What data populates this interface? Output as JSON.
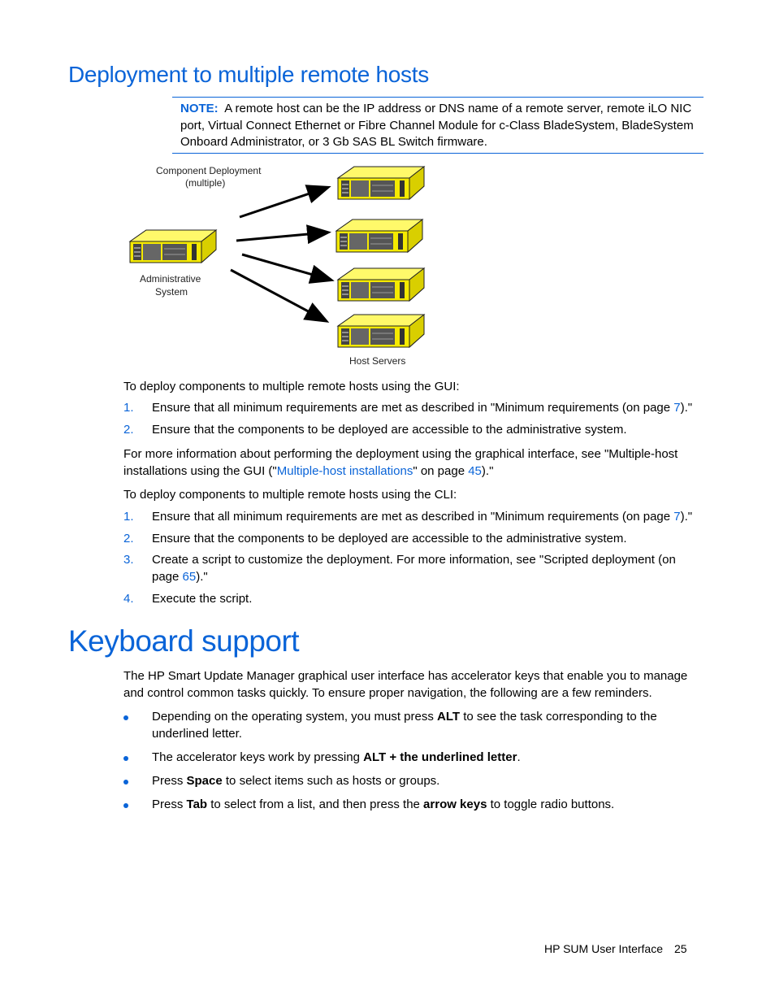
{
  "section1": {
    "title": "Deployment to multiple remote hosts",
    "note": {
      "label": "NOTE:",
      "text": "A remote host can be the IP address or DNS name of a remote server, remote iLO NIC port, Virtual Connect Ethernet or Fibre Channel Module for c-Class BladeSystem, BladeSystem Onboard Administrator, or 3 Gb SAS BL Switch firmware."
    },
    "figure": {
      "caption_top_line1": "Component Deployment",
      "caption_top_line2": "(multiple)",
      "admin_label_line1": "Administrative",
      "admin_label_line2": "System",
      "hosts_label": "Host Servers",
      "host_count": 4
    },
    "gui_intro": "To deploy components to multiple remote hosts using the GUI:",
    "gui_steps": [
      {
        "num": "1.",
        "pre": "Ensure that all minimum requirements are met as described in \"Minimum requirements (on page ",
        "link": "7",
        "post": ").\""
      },
      {
        "num": "2.",
        "text": "Ensure that the components to be deployed are accessible to the administrative system."
      }
    ],
    "more_info": {
      "pre": "For more information about performing the deployment using the graphical interface, see \"Multiple-host installations using the GUI (\"",
      "link1": "Multiple-host installations",
      "mid": "\" on page ",
      "link2": "45",
      "post": ").\""
    },
    "cli_intro": "To deploy components to multiple remote hosts using the CLI:",
    "cli_steps": [
      {
        "num": "1.",
        "pre": "Ensure that all minimum requirements are met as described in \"Minimum requirements (on page ",
        "link": "7",
        "post": ").\""
      },
      {
        "num": "2.",
        "text": "Ensure that the components to be deployed are accessible to the administrative system."
      },
      {
        "num": "3.",
        "pre": "Create a script to customize the deployment. For more information, see \"Scripted deployment (on page ",
        "link": "65",
        "post": ").\""
      },
      {
        "num": "4.",
        "text": "Execute the script."
      }
    ]
  },
  "section2": {
    "title": "Keyboard support",
    "intro": "The HP Smart Update Manager graphical user interface has accelerator keys that enable you to manage and control common tasks quickly. To ensure proper navigation, the following are a few reminders.",
    "bullets": [
      {
        "a": "Depending on the operating system, you must press ",
        "b": "ALT",
        "c": " to see the task corresponding to the underlined letter."
      },
      {
        "a": "The accelerator keys work by pressing ",
        "b": "ALT + the underlined letter",
        "c": "."
      },
      {
        "a": "Press ",
        "b": "Space",
        "c": " to select items such as hosts or groups."
      },
      {
        "a": "Press ",
        "b": "Tab",
        "c": " to select from a list, and then press the ",
        "d": "arrow keys",
        "e": " to toggle radio buttons."
      }
    ]
  },
  "footer": {
    "section": "HP SUM User Interface",
    "page": "25"
  },
  "colors": {
    "accent": "#0a64d8",
    "server_yellow": "#f5ea00"
  }
}
